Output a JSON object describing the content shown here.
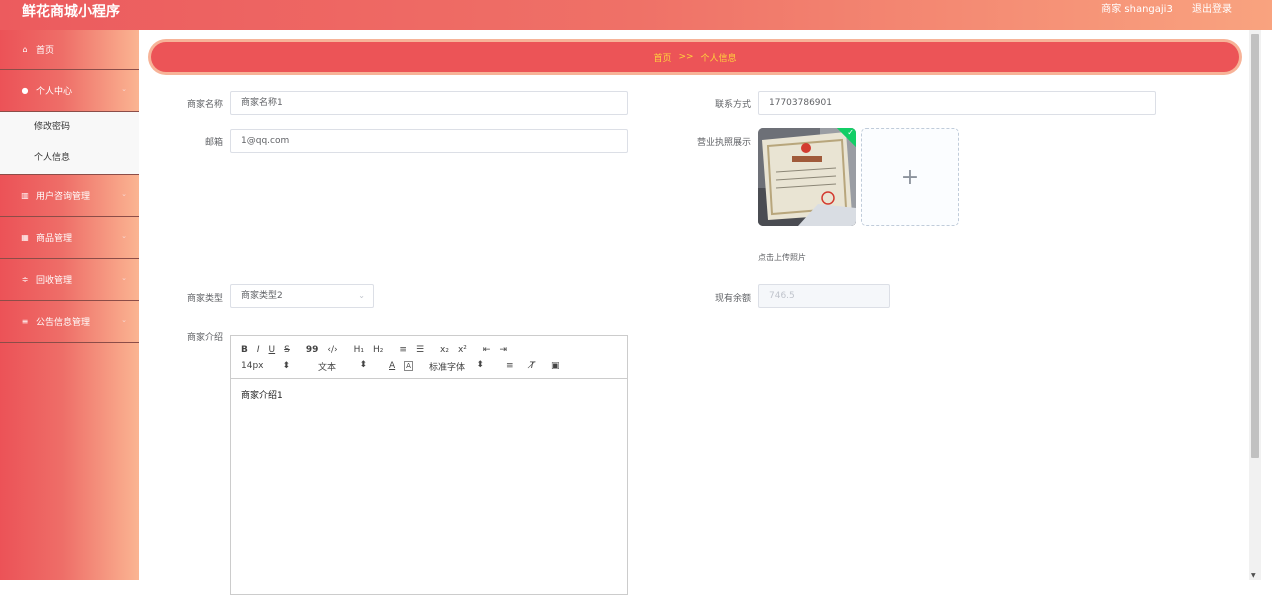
{
  "header": {
    "app_title": "鲜花商城小程序",
    "user_label": "商家 shangaji3",
    "logout_label": "退出登录"
  },
  "sidebar": {
    "items": [
      {
        "label": "首页",
        "icon": "home-icon"
      },
      {
        "label": "个人中心",
        "icon": "user-icon"
      },
      {
        "label": "用户咨询管理",
        "icon": "bar-chart-icon"
      },
      {
        "label": "商品管理",
        "icon": "grid-icon"
      },
      {
        "label": "回收管理",
        "icon": "sliders-icon"
      },
      {
        "label": "公告信息管理",
        "icon": "menu-icon"
      }
    ],
    "subitems": [
      "修改密码",
      "个人信息"
    ]
  },
  "breadcrumb": {
    "home": "首页",
    "separator": ">>",
    "current": "个人信息"
  },
  "form": {
    "merchant_name_label": "商家名称",
    "merchant_name_value": "商家名称1",
    "contact_label": "联系方式",
    "contact_value": "17703786901",
    "email_label": "邮箱",
    "email_value": "1@qq.com",
    "license_label": "营业执照展示",
    "upload_tip": "点击上传照片",
    "type_label": "商家类型",
    "type_value": "商家类型2",
    "balance_label": "现有余额",
    "balance_value": "746.5",
    "intro_label": "商家介绍"
  },
  "editor": {
    "row1": [
      "B",
      "I",
      "U",
      "S",
      "99",
      "‹/›",
      "H₁",
      "H₂",
      "≡",
      "☰",
      "x₂",
      "x²",
      "⇤",
      "⇥"
    ],
    "font_size": "14px",
    "text_type": "文本",
    "font_family": "标准字体",
    "content": "商家介绍1"
  },
  "colors": {
    "accent": "#ec5457",
    "breadcrumb_text": "#ffd33d"
  }
}
